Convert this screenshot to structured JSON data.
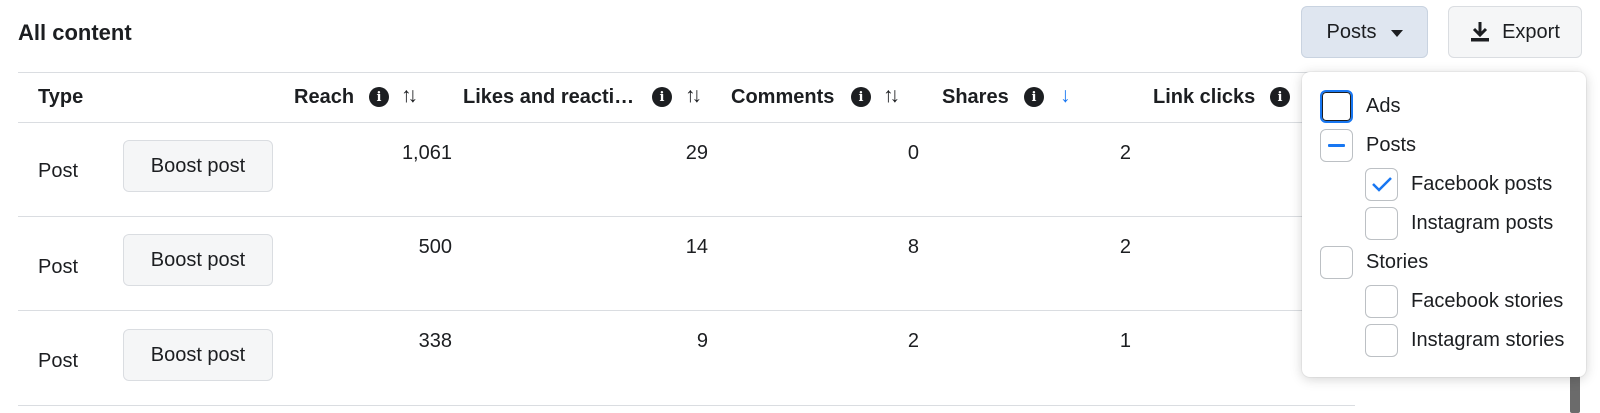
{
  "header": {
    "title": "All content",
    "posts_button": "Posts",
    "export_button": "Export"
  },
  "table": {
    "columns": [
      {
        "key": "type",
        "label": "Type"
      },
      {
        "key": "reach",
        "label": "Reach"
      },
      {
        "key": "likes",
        "label": "Likes and reacti…"
      },
      {
        "key": "comments",
        "label": "Comments"
      },
      {
        "key": "shares",
        "label": "Shares"
      },
      {
        "key": "link_clicks",
        "label": "Link clicks"
      }
    ],
    "sorted_column": "shares",
    "sort_direction": "descending",
    "boost_label": "Boost post",
    "rows": [
      {
        "type": "Post",
        "reach": "1,061",
        "likes": "29",
        "comments": "0",
        "shares": "2"
      },
      {
        "type": "Post",
        "reach": "500",
        "likes": "14",
        "comments": "8",
        "shares": "2"
      },
      {
        "type": "Post",
        "reach": "338",
        "likes": "9",
        "comments": "2",
        "shares": "1"
      }
    ]
  },
  "filter_menu": {
    "options": [
      {
        "label": "Ads",
        "state": "unchecked",
        "level": 0
      },
      {
        "label": "Posts",
        "state": "indeterminate",
        "level": 0
      },
      {
        "label": "Facebook posts",
        "state": "checked",
        "level": 1
      },
      {
        "label": "Instagram posts",
        "state": "unchecked",
        "level": 1
      },
      {
        "label": "Stories",
        "state": "unchecked",
        "level": 0
      },
      {
        "label": "Facebook stories",
        "state": "unchecked",
        "level": 1
      },
      {
        "label": "Instagram stories",
        "state": "unchecked",
        "level": 1
      }
    ]
  },
  "colors": {
    "accent": "#1877f2",
    "text": "#1c1e21",
    "border": "#dadde1",
    "posts_button_bg": "#dfe6f0"
  },
  "icons": {
    "info": "info-icon",
    "sort": "sort-icon",
    "sort_active": "arrow-down-icon",
    "download": "download-icon",
    "caret": "caret-down-icon",
    "check": "check-icon"
  }
}
